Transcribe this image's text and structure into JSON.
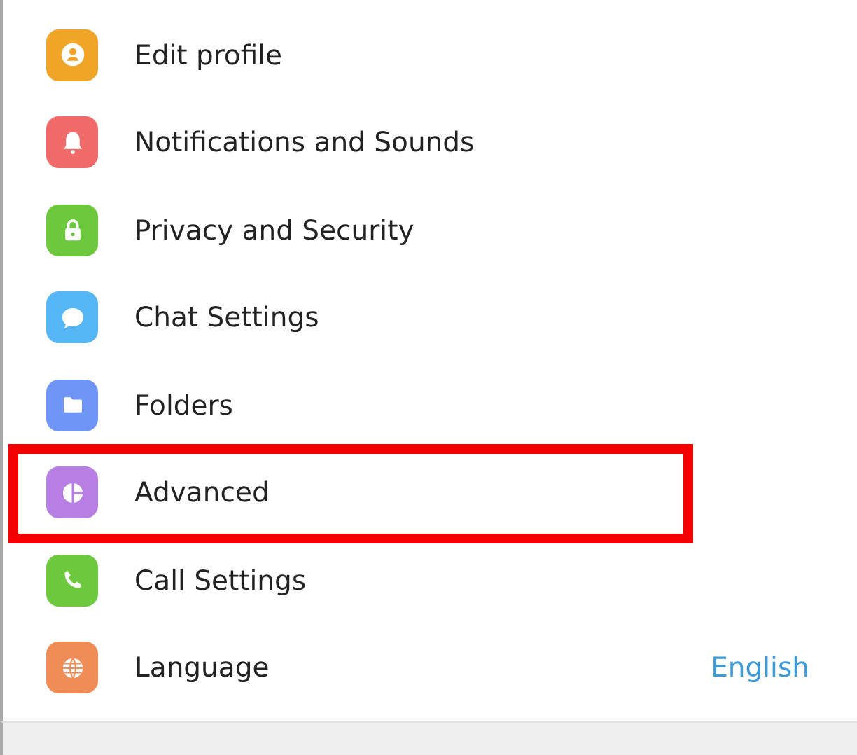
{
  "settings_menu": {
    "items": [
      {
        "kind": "profile",
        "label": "Edit profile",
        "color": "#f0a428",
        "highlighted": false
      },
      {
        "kind": "notifications",
        "label": "Notifications and Sounds",
        "color": "#f06a6a",
        "highlighted": false
      },
      {
        "kind": "privacy",
        "label": "Privacy and Security",
        "color": "#6cc83c",
        "highlighted": false
      },
      {
        "kind": "chat",
        "label": "Chat Settings",
        "color": "#56b5f5",
        "highlighted": false
      },
      {
        "kind": "folders",
        "label": "Folders",
        "color": "#6f95f7",
        "highlighted": false
      },
      {
        "kind": "advanced",
        "label": "Advanced",
        "color": "#b77fe4",
        "highlighted": true
      },
      {
        "kind": "calls",
        "label": "Call Settings",
        "color": "#6cc83c",
        "highlighted": false
      },
      {
        "kind": "language",
        "label": "Language",
        "color": "#f08c56",
        "highlighted": false,
        "value": "English"
      }
    ]
  }
}
